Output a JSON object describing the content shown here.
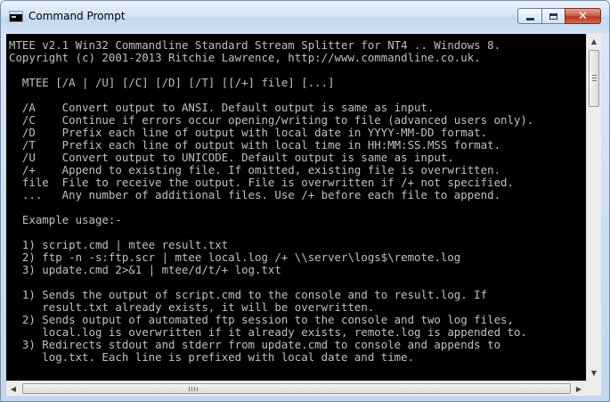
{
  "window": {
    "title": "Command Prompt",
    "icon": "console-icon",
    "controls": {
      "minimize": "minimize-icon",
      "maximize": "maximize-icon",
      "close": "close-icon"
    }
  },
  "console": {
    "lines": [
      "MTEE v2.1 Win32 Commandline Standard Stream Splitter for NT4 .. Windows 8.",
      "Copyright (c) 2001-2013 Ritchie Lawrence, http://www.commandline.co.uk.",
      "",
      "  MTEE [/A | /U] [/C] [/D] [/T] [[/+] file] [...]",
      "",
      "  /A    Convert output to ANSI. Default output is same as input.",
      "  /C    Continue if errors occur opening/writing to file (advanced users only).",
      "  /D    Prefix each line of output with local date in YYYY-MM-DD format.",
      "  /T    Prefix each line of output with local time in HH:MM:SS.MSS format.",
      "  /U    Convert output to UNICODE. Default output is same as input.",
      "  /+    Append to existing file. If omitted, existing file is overwritten.",
      "  file  File to receive the output. File is overwritten if /+ not specified.",
      "  ...   Any number of additional files. Use /+ before each file to append.",
      "",
      "  Example usage:-",
      "",
      "  1) script.cmd | mtee result.txt",
      "  2) ftp -n -s:ftp.scr | mtee local.log /+ \\\\server\\logs$\\remote.log",
      "  3) update.cmd 2>&1 | mtee/d/t/+ log.txt",
      "",
      "  1) Sends the output of script.cmd to the console and to result.log. If",
      "     result.txt already exists, it will be overwritten.",
      "  2) Sends output of automated ftp session to the console and two log files,",
      "     local.log is overwritten if it already exists, remote.log is appended to.",
      "  3) Redirects stdout and stderr from update.cmd to console and appends to",
      "     log.txt. Each line is prefixed with local date and time."
    ]
  },
  "scrollbars": {
    "vertical": {
      "up": "arrow-up-icon",
      "down": "arrow-down-icon"
    },
    "horizontal": {
      "left": "arrow-left-icon",
      "right": "arrow-right-icon"
    }
  },
  "colors": {
    "console_bg": "#000000",
    "console_text": "#c0c0c0",
    "frame": "#c9dbf0"
  }
}
